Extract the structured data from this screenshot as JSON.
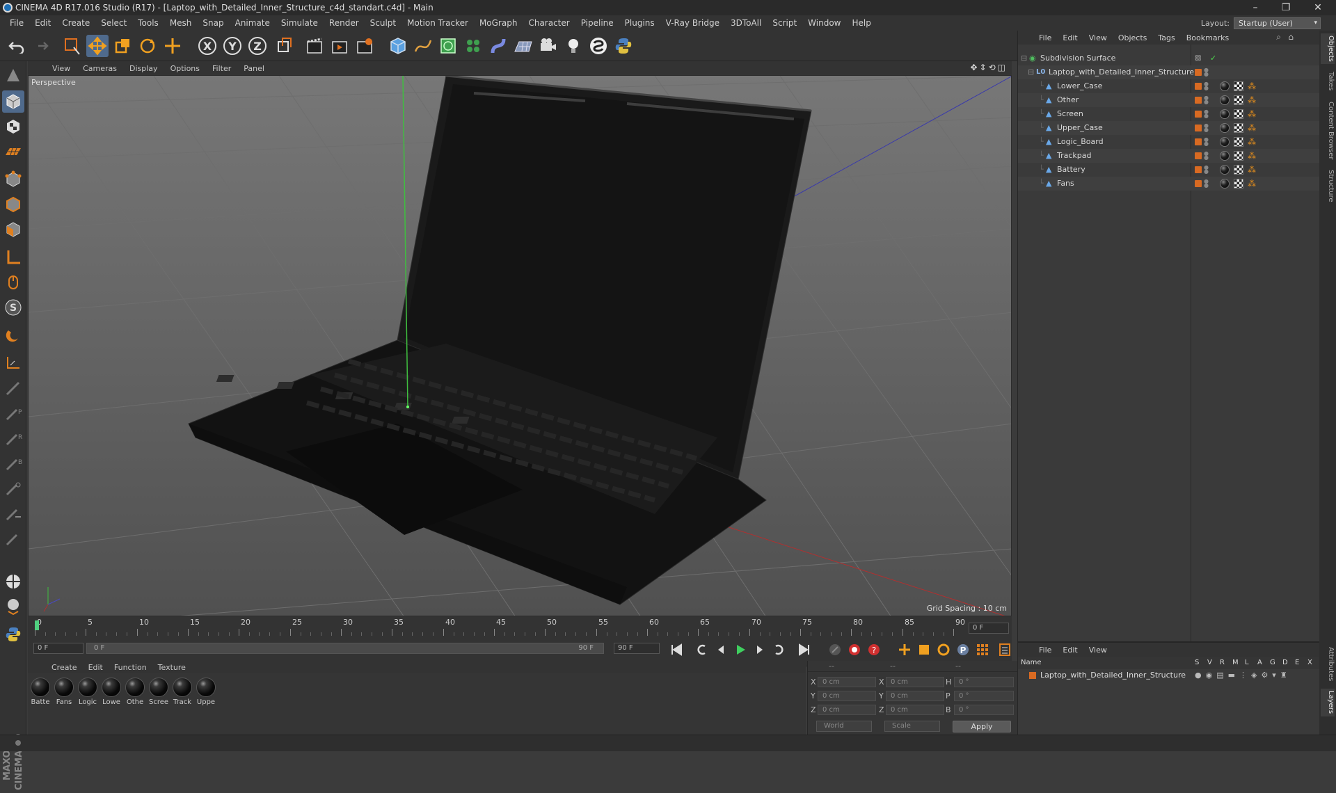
{
  "window": {
    "title": "CINEMA 4D R17.016 Studio (R17) - [Laptop_with_Detailed_Inner_Structure_c4d_standart.c4d] - Main",
    "minimize": "–",
    "maximize": "❐",
    "close": "✕"
  },
  "menubar": {
    "items": [
      "File",
      "Edit",
      "Create",
      "Select",
      "Tools",
      "Mesh",
      "Snap",
      "Animate",
      "Simulate",
      "Render",
      "Sculpt",
      "Motion Tracker",
      "MoGraph",
      "Character",
      "Pipeline",
      "Plugins",
      "V-Ray Bridge",
      "3DToAll",
      "Script",
      "Window",
      "Help"
    ],
    "layout_label": "Layout:",
    "layout_value": "Startup (User)"
  },
  "toolbar": {
    "axis_x": "X",
    "axis_y": "Y",
    "axis_z": "Z"
  },
  "viewport": {
    "menu": [
      "View",
      "Cameras",
      "Display",
      "Options",
      "Filter",
      "Panel"
    ],
    "label": "Perspective",
    "grid_spacing": "Grid Spacing : 10 cm"
  },
  "timeline": {
    "ticks": [
      "0",
      "5",
      "10",
      "15",
      "20",
      "25",
      "30",
      "35",
      "40",
      "45",
      "50",
      "55",
      "60",
      "65",
      "70",
      "75",
      "80",
      "85",
      "90"
    ],
    "current_frame": "0 F",
    "start_field": "0 F",
    "range_start": "0 F",
    "range_end": "90 F",
    "end_field": "90 F"
  },
  "materials": {
    "menu": [
      "Create",
      "Edit",
      "Function",
      "Texture"
    ],
    "items": [
      "Batte",
      "Fans",
      "Logic",
      "Lowe",
      "Othe",
      "Scree",
      "Track",
      "Uppe"
    ]
  },
  "coordinates": {
    "col_headers": [
      "--",
      "--",
      "--"
    ],
    "rows": [
      {
        "a1": "X",
        "v1": "0 cm",
        "a2": "X",
        "v2": "0 cm",
        "a3": "H",
        "v3": "0 °"
      },
      {
        "a1": "Y",
        "v1": "0 cm",
        "a2": "Y",
        "v2": "0 cm",
        "a3": "P",
        "v3": "0 °"
      },
      {
        "a1": "Z",
        "v1": "0 cm",
        "a2": "Z",
        "v2": "0 cm",
        "a3": "B",
        "v3": "0 °"
      }
    ],
    "world": "World",
    "scale": "Scale",
    "apply": "Apply"
  },
  "objects": {
    "menu": [
      "File",
      "Edit",
      "View",
      "Objects",
      "Tags",
      "Bookmarks"
    ],
    "root": "Subdivision Surface",
    "group": "Laptop_with_Detailed_Inner_Structure",
    "children": [
      "Lower_Case",
      "Other",
      "Screen",
      "Upper_Case",
      "Logic_Board",
      "Trackpad",
      "Battery",
      "Fans"
    ]
  },
  "layers": {
    "menu": [
      "File",
      "Edit",
      "View"
    ],
    "header_name": "Name",
    "header_cols": [
      "S",
      "V",
      "R",
      "M",
      "L",
      "A",
      "G",
      "D",
      "E",
      "X"
    ],
    "row": "Laptop_with_Detailed_Inner_Structure"
  },
  "right_tabs": [
    "Objects",
    "Takes",
    "Content Browser",
    "Structure",
    "Attributes",
    "Layers"
  ],
  "branding": "MAXON CINEMA 4D",
  "colors": {
    "accent_blue": "#4f6a8c",
    "layer_orange": "#d86a22",
    "axis_green": "#3fbf3f",
    "axis_red": "#c03030",
    "axis_blue": "#3030c0"
  }
}
